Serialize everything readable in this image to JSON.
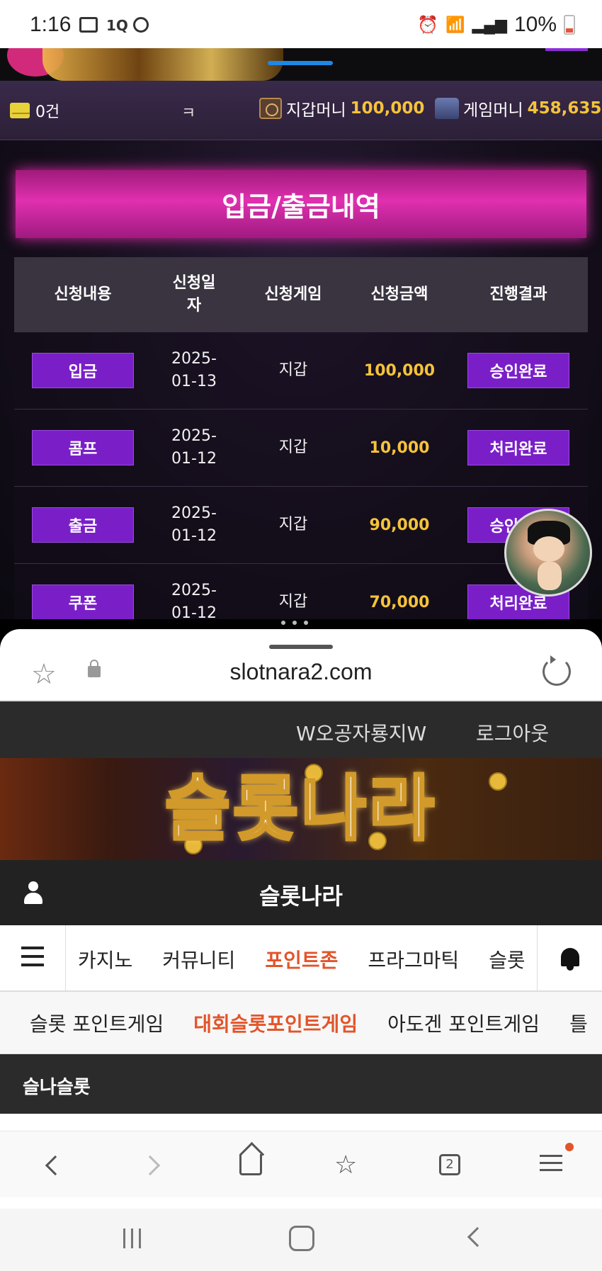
{
  "status_bar": {
    "time": "1:16",
    "battery": "10%"
  },
  "top_app": {
    "messages": "0건",
    "ticker_fragment": "ㅋ",
    "wallet_label": "지갑머니",
    "wallet_amount": "100,000",
    "game_label": "게임머니",
    "game_amount": "458,635",
    "page_title": "입금/출금내역",
    "table": {
      "headers": [
        "신청내용",
        "신청일자",
        "신청게임",
        "신청금액",
        "진행결과"
      ],
      "header_date_line1": "신청일",
      "header_date_line2": "자",
      "rows": [
        {
          "type": "입금",
          "date1": "2025-",
          "date2": "01-13",
          "game": "지갑",
          "amount": "100,000",
          "result": "승인완료"
        },
        {
          "type": "콤프",
          "date1": "2025-",
          "date2": "01-12",
          "game": "지갑",
          "amount": "10,000",
          "result": "처리완료"
        },
        {
          "type": "출금",
          "date1": "2025-",
          "date2": "01-12",
          "game": "지갑",
          "amount": "90,000",
          "result": "승인완료"
        },
        {
          "type": "쿠폰",
          "date1": "2025-",
          "date2": "01-12",
          "game": "지갑",
          "amount": "70,000",
          "result": "처리완료"
        }
      ]
    },
    "colors": {
      "accent_purple": "#7a1fc8",
      "amount_gold": "#f5c33a",
      "banner_pink": "#e030b0"
    }
  },
  "browser": {
    "url": "slotnara2.com",
    "site": {
      "user_name": "W오공자룡지W",
      "logout": "로그아웃",
      "banner_title": "슬롯나라",
      "site_name": "슬롯나라",
      "nav_main": [
        "카지노",
        "커뮤니티",
        "포인트존",
        "프라그마틱",
        "슬롯"
      ],
      "nav_main_active": "포인트존",
      "nav_sub": [
        "슬롯 포인트게임",
        "대회슬롯포인트게임",
        "아도겐 포인트게임",
        "틀"
      ],
      "nav_sub_active": "대회슬롯포인트게임",
      "section_title": "슬나슬롯",
      "active_color": "#e2552a"
    },
    "tabbar": {
      "tabs_count": "2"
    }
  }
}
